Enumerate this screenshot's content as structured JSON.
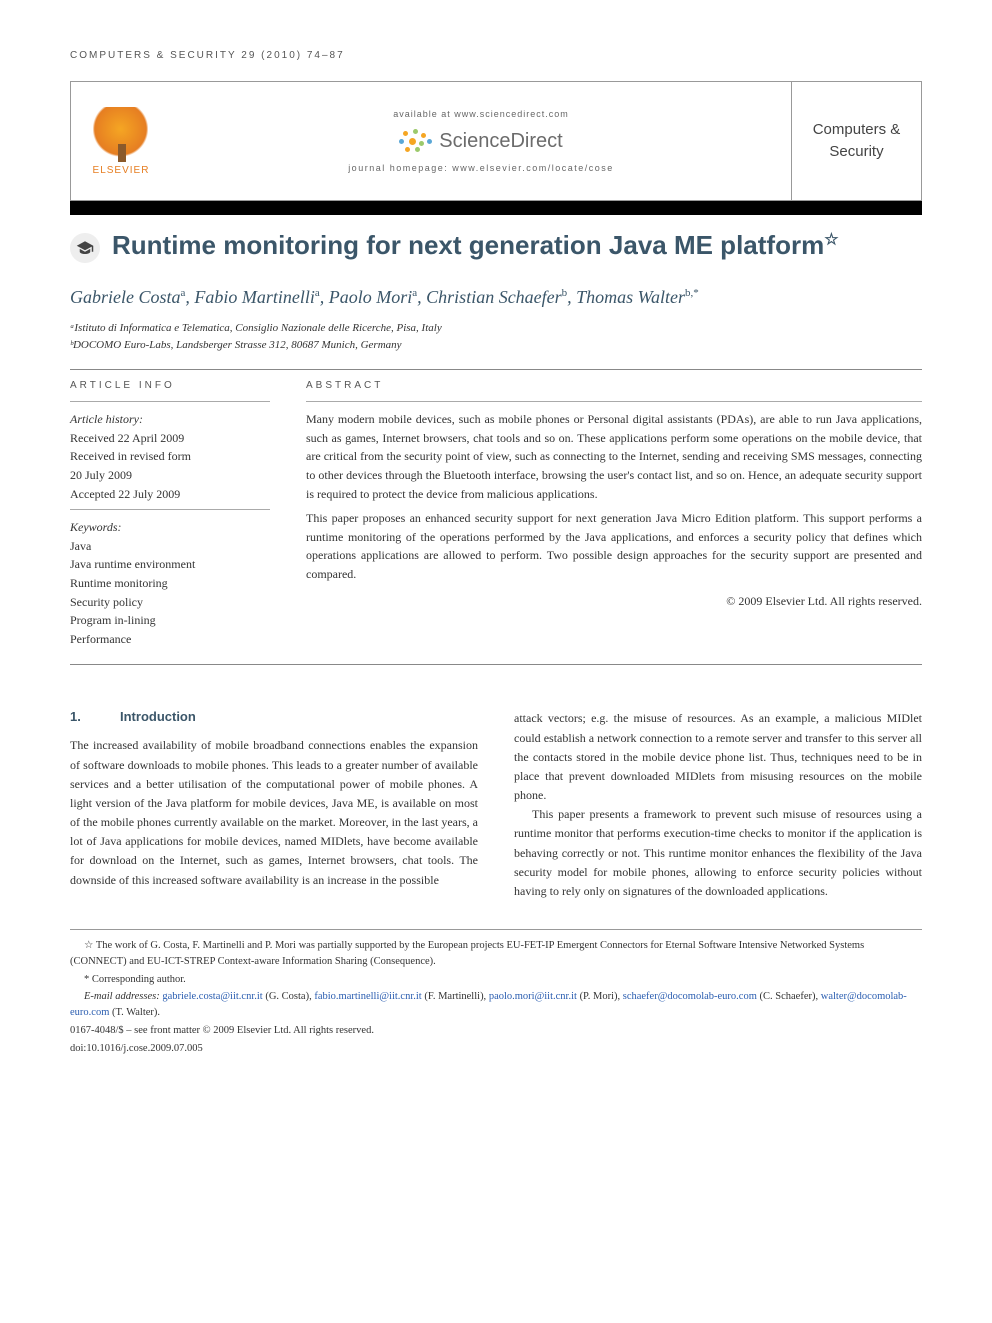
{
  "running_head": "COMPUTERS & SECURITY 29 (2010) 74–87",
  "header": {
    "available_at": "available at www.sciencedirect.com",
    "sd_brand": "ScienceDirect",
    "homepage": "journal homepage: www.elsevier.com/locate/cose",
    "publisher": "ELSEVIER",
    "journal_cover": "Computers & Security"
  },
  "article": {
    "title": "Runtime monitoring for next generation Java ME platform",
    "title_marker": "☆",
    "authors_html": "Gabriele Costa<sup>a</sup>, Fabio Martinelli<sup>a</sup>, Paolo Mori<sup>a</sup>, Christian Schaefer<sup>b</sup>, Thomas Walter<sup>b,*</sup>",
    "affiliations": [
      "ᵃIstituto di Informatica e Telematica, Consiglio Nazionale delle Ricerche, Pisa, Italy",
      "ᵇDOCOMO Euro-Labs, Landsberger Strasse 312, 80687 Munich, Germany"
    ]
  },
  "article_info": {
    "heading": "ARTICLE INFO",
    "history_label": "Article history:",
    "received": "Received 22 April 2009",
    "revised_label": "Received in revised form",
    "revised_date": "20 July 2009",
    "accepted": "Accepted 22 July 2009",
    "keywords_label": "Keywords:",
    "keywords": [
      "Java",
      "Java runtime environment",
      "Runtime monitoring",
      "Security policy",
      "Program in-lining",
      "Performance"
    ]
  },
  "abstract": {
    "heading": "ABSTRACT",
    "p1": "Many modern mobile devices, such as mobile phones or Personal digital assistants (PDAs), are able to run Java applications, such as games, Internet browsers, chat tools and so on. These applications perform some operations on the mobile device, that are critical from the security point of view, such as connecting to the Internet, sending and receiving SMS messages, connecting to other devices through the Bluetooth interface, browsing the user's contact list, and so on. Hence, an adequate security support is required to protect the device from malicious applications.",
    "p2": "This paper proposes an enhanced security support for next generation Java Micro Edition platform. This support performs a runtime monitoring of the operations performed by the Java applications, and enforces a security policy that defines which operations applications are allowed to perform. Two possible design approaches for the security support are presented and compared.",
    "copyright": "© 2009 Elsevier Ltd. All rights reserved."
  },
  "body": {
    "section_number": "1.",
    "section_title": "Introduction",
    "col1_p1": "The increased availability of mobile broadband connections enables the expansion of software downloads to mobile phones. This leads to a greater number of available services and a better utilisation of the computational power of mobile phones. A light version of the Java platform for mobile devices, Java ME, is available on most of the mobile phones currently available on the market. Moreover, in the last years, a lot of Java applications for mobile devices, named MIDlets, have become available for download on the Internet, such as games, Internet browsers, chat tools. The downside of this increased software availability is an increase in the possible",
    "col2_p1": "attack vectors; e.g. the misuse of resources. As an example, a malicious MIDlet could establish a network connection to a remote server and transfer to this server all the contacts stored in the mobile device phone list. Thus, techniques need to be in place that prevent downloaded MIDlets from misusing resources on the mobile phone.",
    "col2_p2": "This paper presents a framework to prevent such misuse of resources using a runtime monitor that performs execution-time checks to monitor if the application is behaving correctly or not. This runtime monitor enhances the flexibility of the Java security model for mobile phones, allowing to enforce security policies without having to rely only on signatures of the downloaded applications."
  },
  "footnotes": {
    "funding": "☆ The work of G. Costa, F. Martinelli and P. Mori was partially supported by the European projects EU-FET-IP Emergent Connectors for Eternal Software Intensive Networked Systems (CONNECT) and EU-ICT-STREP Context-aware Information Sharing (Consequence).",
    "corr": "* Corresponding author.",
    "emails_label": "E-mail addresses: ",
    "emails": [
      {
        "addr": "gabriele.costa@iit.cnr.it",
        "who": "(G. Costa)"
      },
      {
        "addr": "fabio.martinelli@iit.cnr.it",
        "who": "(F. Martinelli)"
      },
      {
        "addr": "paolo.mori@iit.cnr.it",
        "who": "(P. Mori)"
      },
      {
        "addr": "schaefer@docomolab-euro.com",
        "who": "(C. Schaefer)"
      },
      {
        "addr": "walter@docomolab-euro.com",
        "who": "(T. Walter)"
      }
    ],
    "issn": "0167-4048/$ – see front matter © 2009 Elsevier Ltd. All rights reserved.",
    "doi": "doi:10.1016/j.cose.2009.07.005"
  }
}
